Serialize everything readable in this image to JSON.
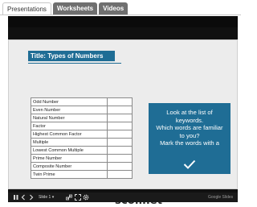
{
  "tabs": [
    {
      "label": "Presentations",
      "active": true
    },
    {
      "label": "Worksheets",
      "active": false
    },
    {
      "label": "Videos",
      "active": false
    }
  ],
  "slide": {
    "title": "Title: Types of Numbers",
    "terms": [
      "Odd Number",
      "Even Number",
      "Natural Number",
      "Factor",
      "Highest Common Factor",
      "Multiple",
      "Lowest Common Multiple",
      "Prime Number",
      "Composite Number",
      "Twin Prime"
    ],
    "callout_lines": [
      "Look at the list of",
      "keywords.",
      "Which words are familiar",
      "to you?",
      "Mark the words with a"
    ],
    "logo_text": "scoilnet",
    "brand_color": "#1f6d95"
  },
  "player": {
    "page_indicator": "Slide 1",
    "brand_label": "Google Slides"
  }
}
